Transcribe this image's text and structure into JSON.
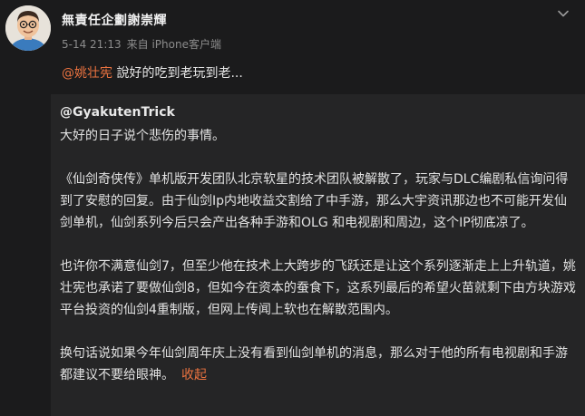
{
  "post": {
    "author": "無責任企劃謝崇輝",
    "date": "5-14 21:13",
    "source": "来自 iPhone客户端",
    "comment_mention": "@姚壮宪",
    "comment_text": " 說好的吃到老玩到老...",
    "more_icon": "chevron-down-icon"
  },
  "repost": {
    "author": "@GyakutenTrick",
    "paragraphs": [
      "大好的日子说个悲伤的事情。",
      "《仙剑奇侠传》单机版开发团队北京软星的技术团队被解散了，玩家与DLC编剧私信询问得到了安慰的回复。由于仙剑Ip内地收益交割给了中手游，那么大宇资讯那边也不可能开发仙剑单机，仙剑系列今后只会产出各种手游和OLG 和电视剧和周边，这个IP彻底凉了。",
      "也许你不满意仙剑7，但至少他在技术上大跨步的飞跃还是让这个系列逐渐走上上升轨道，姚壮宪也承诺了要做仙剑8，但如今在资本的蚕食下，这系列最后的希望火苗就剩下由方块游戏平台投资的仙剑4重制版，但网上传闻上软也在解散范围内。",
      "换句话说如果今年仙剑周年庆上没有看到仙剑单机的消息，那么对于他的所有电视剧和手游都建议不要给眼神。"
    ],
    "collapse_label": "收起"
  },
  "colors": {
    "background": "#1b1b1c",
    "repost_background": "#252526",
    "accent": "#eb7340",
    "meta": "#8c8c8c"
  }
}
